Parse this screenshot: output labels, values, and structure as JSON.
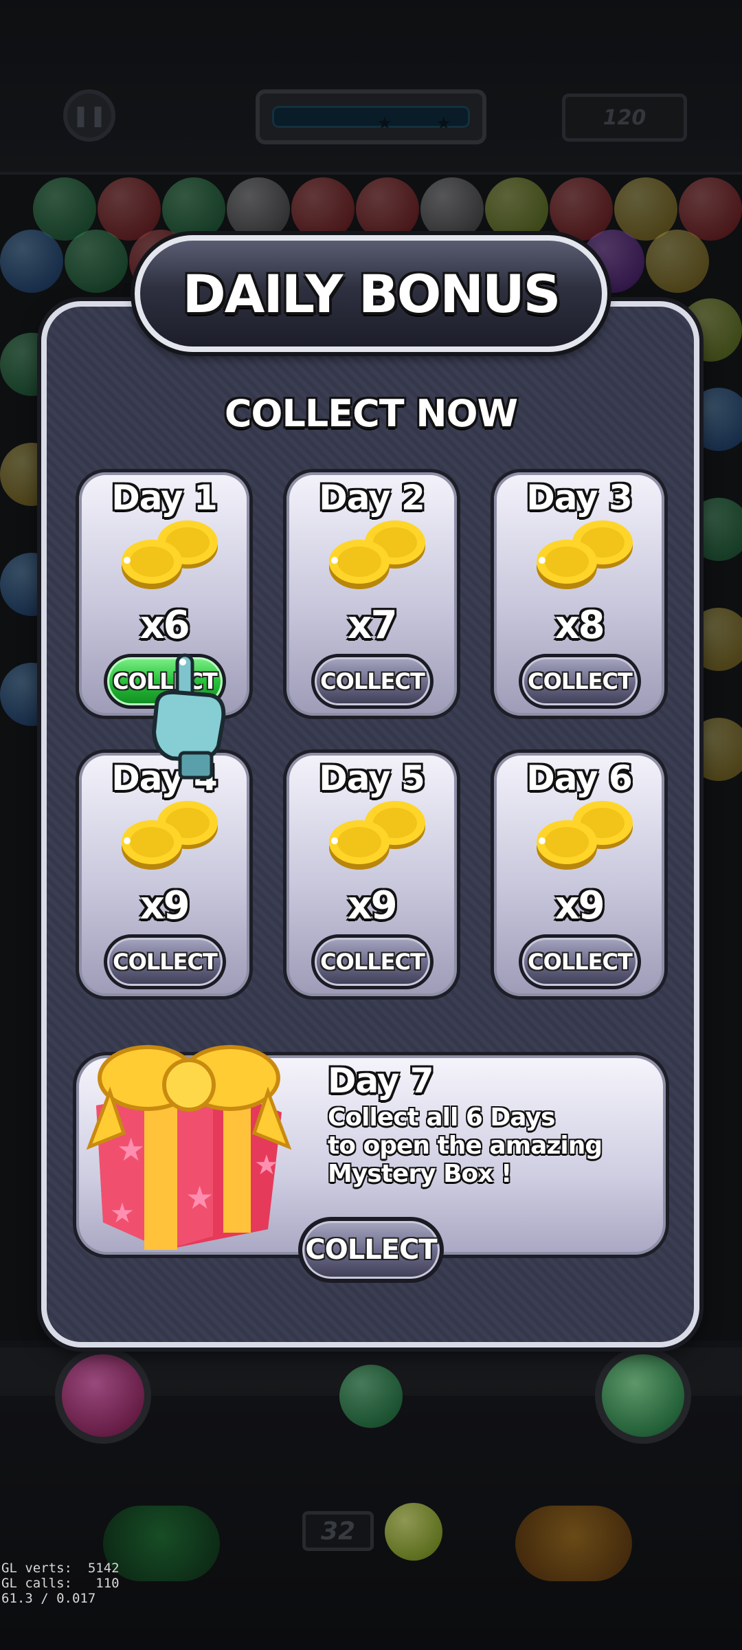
{
  "hud": {
    "pause_icon": "pause-icon",
    "score": "120",
    "shots_left": "32"
  },
  "dialog": {
    "title": "DAILY BONUS",
    "subtitle": "COLLECT NOW",
    "days": [
      {
        "label": "Day 1",
        "amount": "x6",
        "button": "COLLECT",
        "active": true
      },
      {
        "label": "Day 2",
        "amount": "x7",
        "button": "COLLECT",
        "active": false
      },
      {
        "label": "Day 3",
        "amount": "x8",
        "button": "COLLECT",
        "active": false
      },
      {
        "label": "Day 4",
        "amount": "x9",
        "button": "COLLECT",
        "active": false
      },
      {
        "label": "Day 5",
        "amount": "x9",
        "button": "COLLECT",
        "active": false
      },
      {
        "label": "Day 6",
        "amount": "x9",
        "button": "COLLECT",
        "active": false
      }
    ],
    "day7": {
      "label": "Day 7",
      "description_lines": [
        "Collect all 6 Days",
        "to open the amazing",
        "Mystery Box !"
      ],
      "button": "COLLECT"
    }
  },
  "debug": {
    "line1": "GL verts:  5142",
    "line2": "GL calls:   110",
    "line3": "61.3 / 0.017"
  },
  "colors": {
    "active_button": "#27c23a",
    "panel": "#3b3e52",
    "coin": "#f2c318"
  }
}
